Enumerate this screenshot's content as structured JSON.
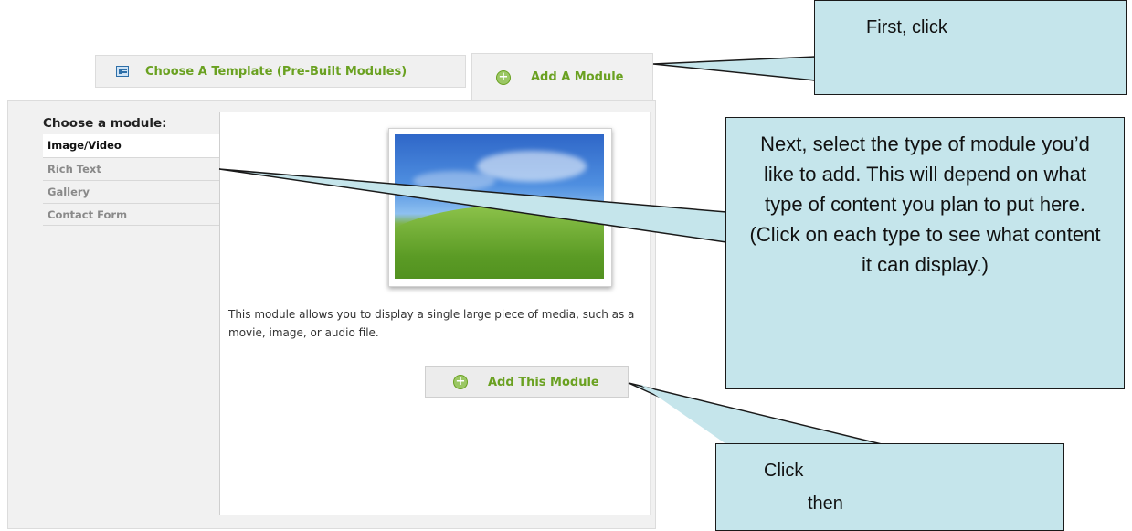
{
  "tabs": [
    {
      "label": "Choose A Template (Pre-Built Modules)",
      "icon": "template-grid-icon"
    },
    {
      "label": "Add A Module",
      "icon": "plus-circle-icon"
    }
  ],
  "sidebar": {
    "heading": "Choose a module:",
    "items": [
      {
        "label": "Image/Video",
        "active": true
      },
      {
        "label": "Rich Text"
      },
      {
        "label": "Gallery"
      },
      {
        "label": "Contact Form"
      }
    ]
  },
  "main": {
    "description": "This module allows you to display a single large piece of media, such as a movie, image, or audio file.",
    "add_button": "Add This Module"
  },
  "callouts": {
    "first": "First, click",
    "next": "Next, select the type of module you’d like to add. This will depend on what type of content you plan to put here.  (Click on each type to see what content it can display.)",
    "click": "Click",
    "then": "then"
  },
  "colors": {
    "accent_green": "#6aa121",
    "callout_fill": "#c5e5eb"
  }
}
